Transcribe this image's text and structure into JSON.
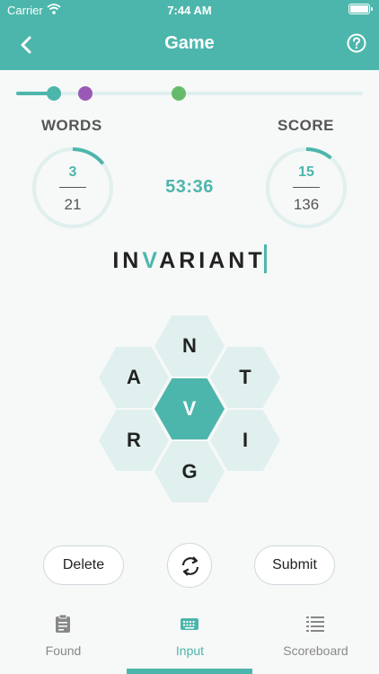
{
  "status_bar": {
    "carrier": "Carrier",
    "time": "7:44 AM"
  },
  "nav": {
    "title": "Game",
    "back_icon": "chevron-left-icon",
    "help_icon": "question-circle-icon"
  },
  "progress": {
    "value": 0.11,
    "milestones": [
      {
        "position": 0.11,
        "color": "#4db6ac",
        "reached": true
      },
      {
        "position": 0.2,
        "color": "#9b59b6",
        "reached": false
      },
      {
        "position": 0.47,
        "color": "#66bb6a",
        "reached": false
      }
    ]
  },
  "words": {
    "label": "WORDS",
    "found": "3",
    "total": "21",
    "fraction": 0.143
  },
  "score": {
    "label": "SCORE",
    "current": "15",
    "total": "136",
    "fraction": 0.11
  },
  "timer": "53:36",
  "current_word": {
    "before": "IN",
    "center": "V",
    "after": "ARIANT"
  },
  "letters": {
    "center": "V",
    "top": "N",
    "upper_left": "A",
    "upper_right": "T",
    "lower_left": "R",
    "lower_right": "I",
    "bottom": "G"
  },
  "actions": {
    "delete": "Delete",
    "shuffle_icon": "shuffle-icon",
    "submit": "Submit"
  },
  "tabs": [
    {
      "label": "Found",
      "icon": "clipboard-icon",
      "active": false
    },
    {
      "label": "Input",
      "icon": "keyboard-icon",
      "active": true
    },
    {
      "label": "Scoreboard",
      "icon": "list-icon",
      "active": false
    }
  ],
  "colors": {
    "accent": "#4db6ac",
    "accent_light": "#dff0ee",
    "milestone_purple": "#9b59b6",
    "milestone_green": "#66bb6a"
  }
}
